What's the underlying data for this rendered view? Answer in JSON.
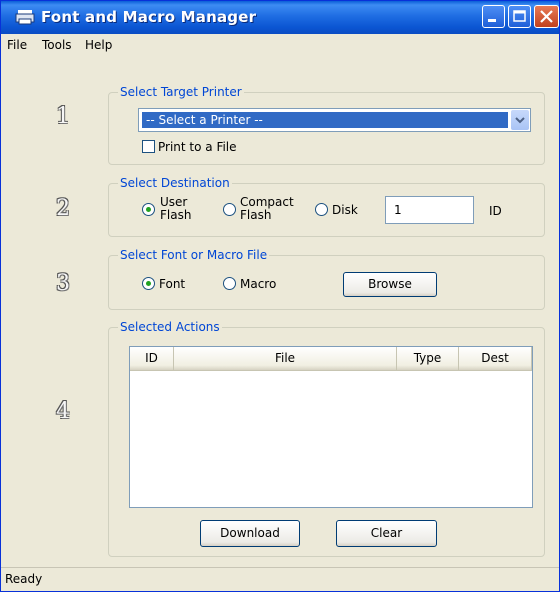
{
  "window": {
    "title": "Font and Macro Manager",
    "title_icon": "printer-icon"
  },
  "menu": {
    "file": "File",
    "tools": "Tools",
    "help": "Help"
  },
  "steps": [
    "1",
    "2",
    "3",
    "4"
  ],
  "target_printer": {
    "legend": "Select Target Printer",
    "selected": "-- Select a Printer --",
    "print_to_file_label": "Print to a File",
    "print_to_file_checked": false
  },
  "destination": {
    "legend": "Select Destination",
    "options": [
      {
        "line1": "User",
        "line2": "Flash",
        "selected": true
      },
      {
        "line1": "Compact",
        "line2": "Flash",
        "selected": false
      },
      {
        "line1": "Disk",
        "line2": "",
        "selected": false
      }
    ],
    "id_value": "1",
    "id_label": "ID"
  },
  "font_macro": {
    "legend": "Select Font or Macro File",
    "font_label": "Font",
    "macro_label": "Macro",
    "font_selected": true,
    "browse_label": "Browse"
  },
  "actions": {
    "legend": "Selected Actions",
    "columns": [
      "ID",
      "File",
      "Type",
      "Dest"
    ],
    "rows": [],
    "download_label": "Download",
    "clear_label": "Clear"
  },
  "status": "Ready",
  "colors": {
    "title_bar": "#0a5fd8",
    "legend_text": "#0046d5",
    "selection": "#316ac5",
    "window_bg": "#ece9d8"
  }
}
